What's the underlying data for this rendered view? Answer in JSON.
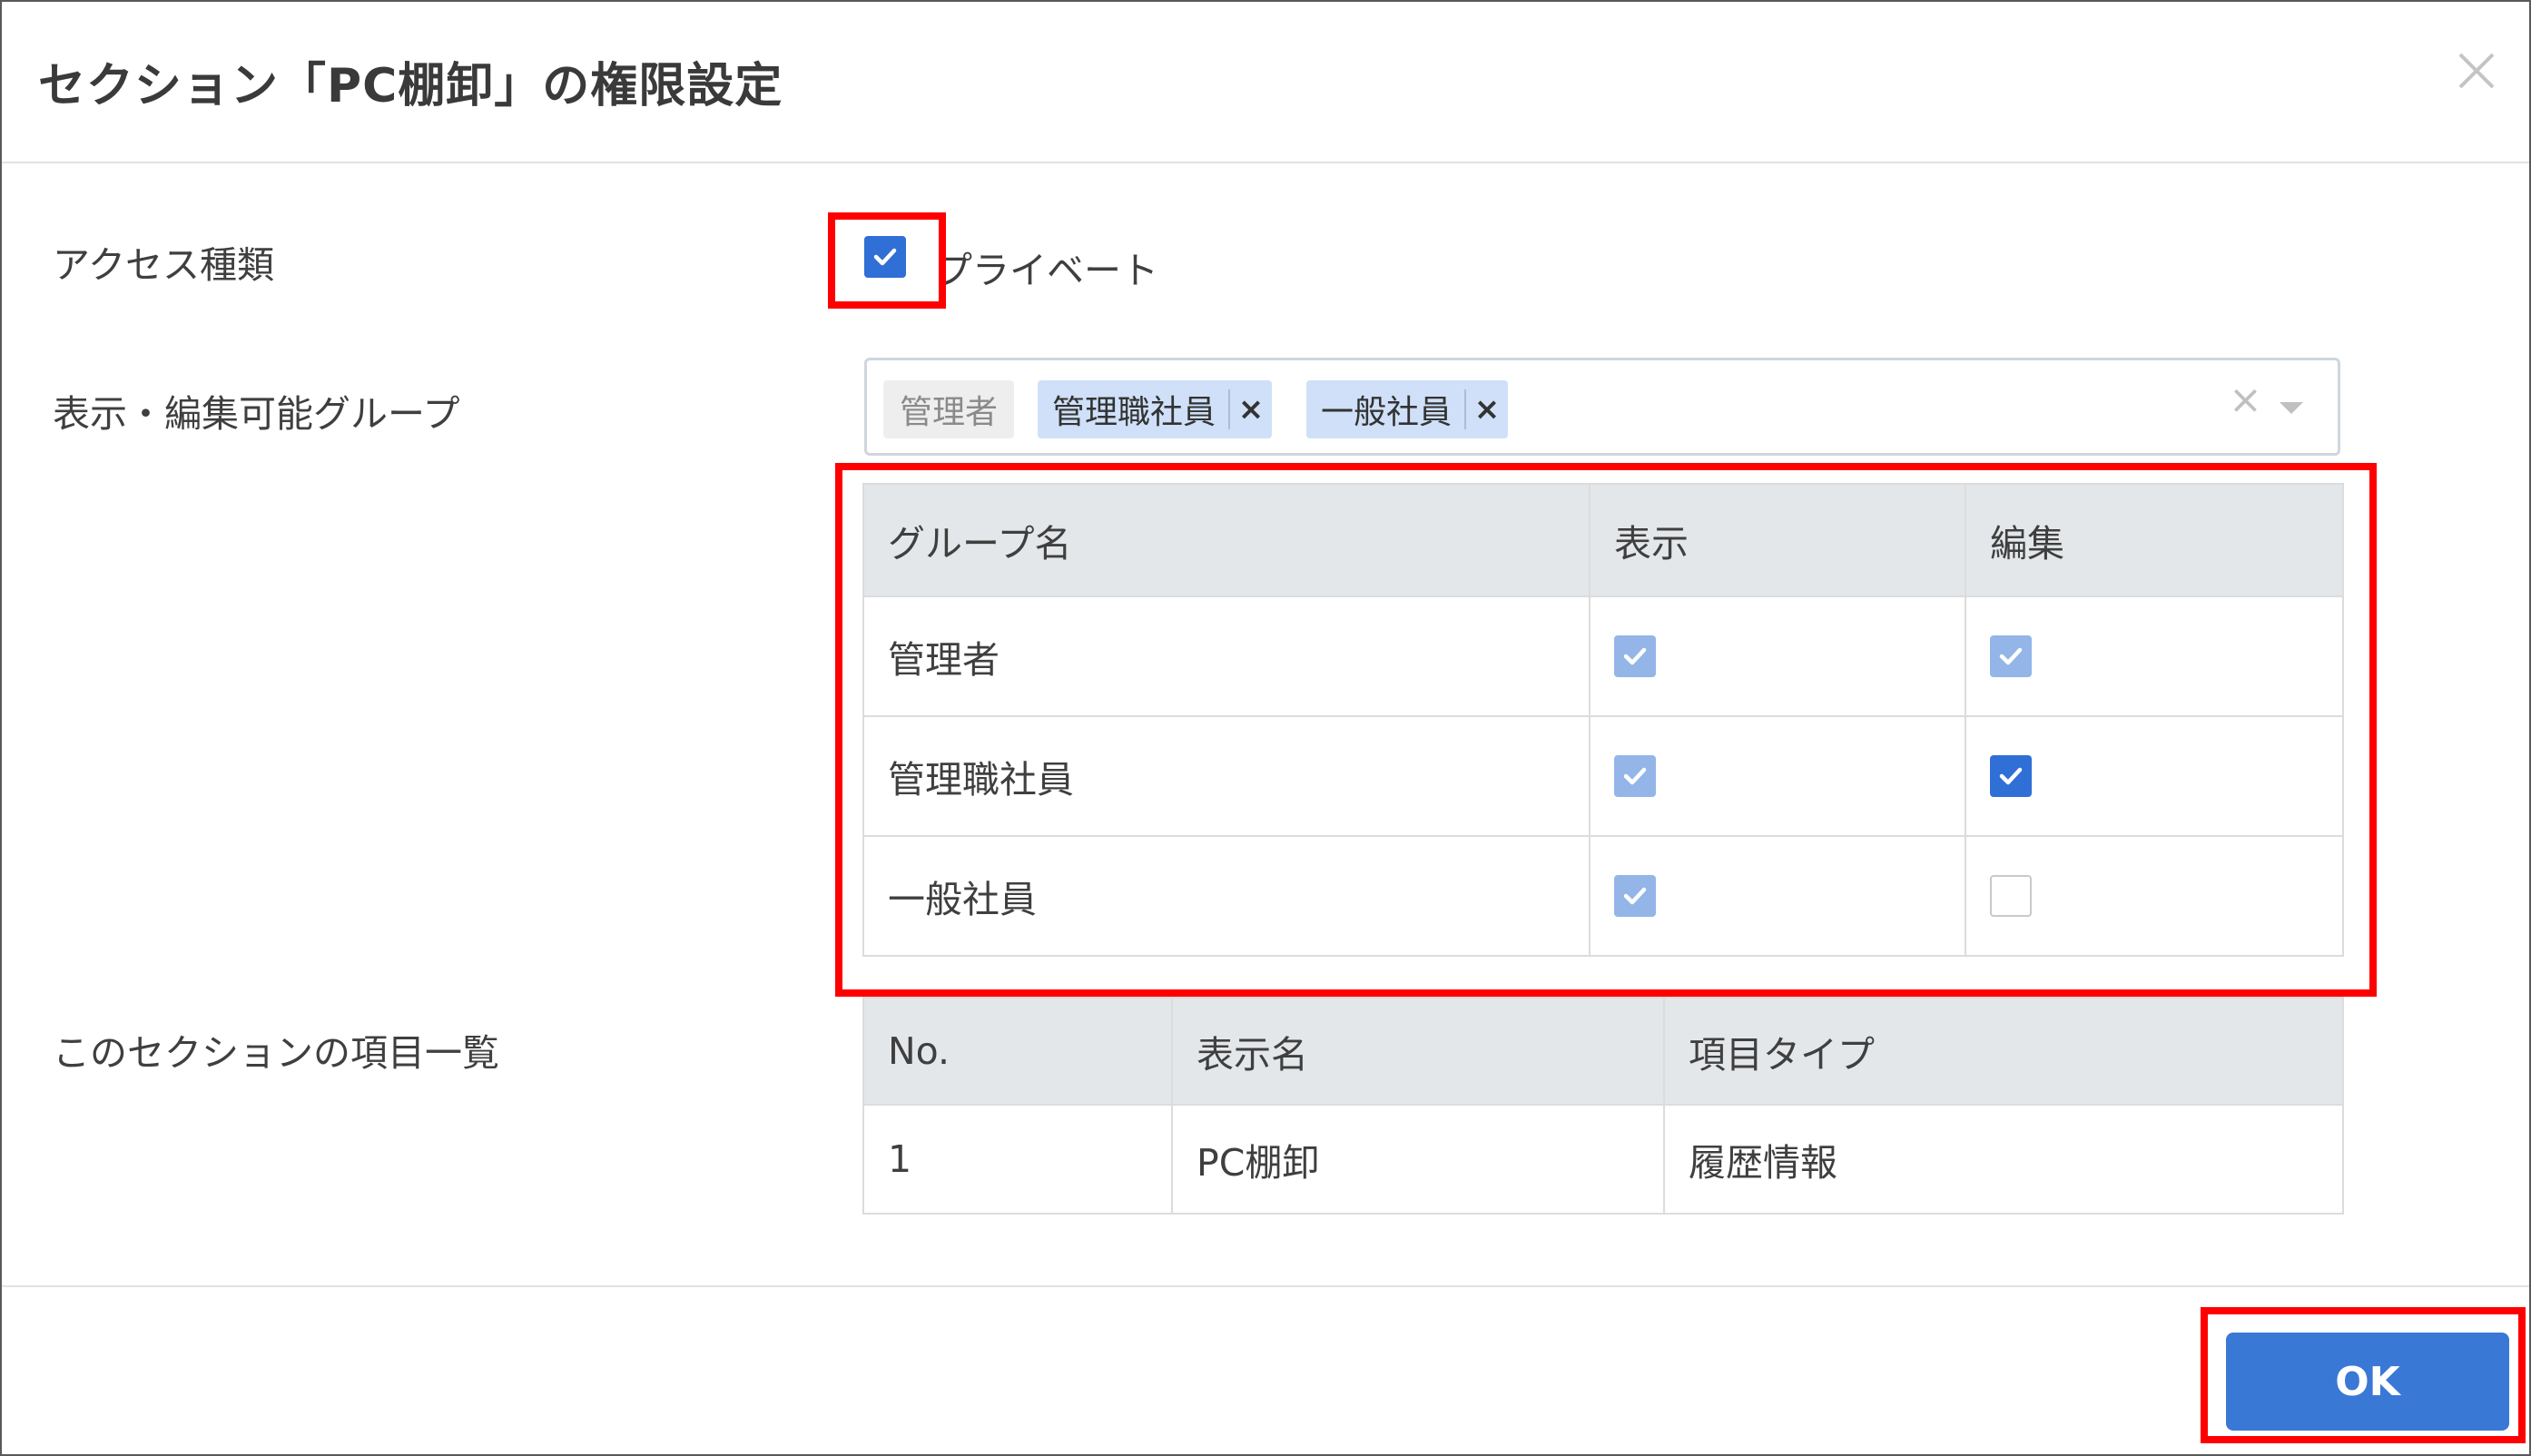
{
  "colors": {
    "accent": "#3a78d6",
    "checked": "#2f6fd6",
    "checked_dim": "#93b5e8",
    "highlight": "#ff0000"
  },
  "dialog": {
    "title": "セクション「PC棚卸」の権限設定",
    "close_icon": "close-icon"
  },
  "access_type": {
    "label": "アクセス種類",
    "private_label": "プライベート",
    "private_checked": true
  },
  "groups": {
    "label": "表示・編集可能グループ",
    "fixed_tag": "管理者",
    "tags": [
      "管理職社員",
      "一般社員"
    ],
    "remove_symbol": "×",
    "clear_symbol": "×"
  },
  "permissions_table": {
    "headers": [
      "グループ名",
      "表示",
      "編集"
    ],
    "rows": [
      {
        "name": "管理者",
        "view": "dim",
        "edit": "dim"
      },
      {
        "name": "管理職社員",
        "view": "dim",
        "edit": "on"
      },
      {
        "name": "一般社員",
        "view": "dim",
        "edit": "off"
      }
    ]
  },
  "items": {
    "label": "このセクションの項目一覧",
    "headers": [
      "No.",
      "表示名",
      "項目タイプ"
    ],
    "rows": [
      {
        "no": "1",
        "name": "PC棚卸",
        "type": "履歴情報"
      }
    ]
  },
  "footer": {
    "ok_label": "OK"
  }
}
